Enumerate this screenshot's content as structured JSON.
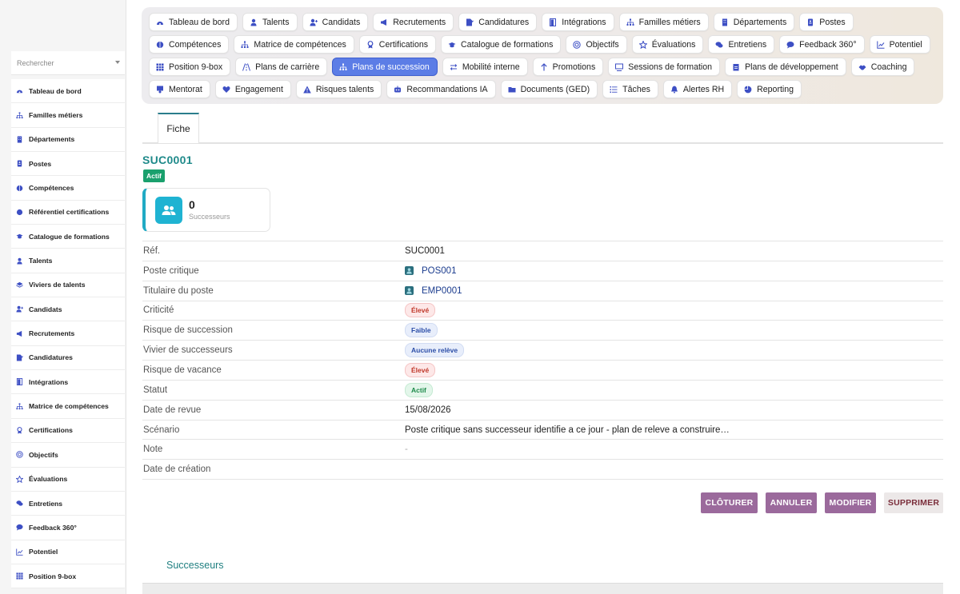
{
  "sidebar": {
    "search_placeholder": "Rechercher",
    "items": [
      {
        "label": "Tableau de bord",
        "icon": "dashboard-icon"
      },
      {
        "label": "Familles métiers",
        "icon": "sitemap-icon"
      },
      {
        "label": "Départements",
        "icon": "building-icon"
      },
      {
        "label": "Postes",
        "icon": "badge-icon"
      },
      {
        "label": "Compétences",
        "icon": "brain-icon"
      },
      {
        "label": "Référentiel certifications",
        "icon": "certificate-icon"
      },
      {
        "label": "Catalogue de formations",
        "icon": "graduation-cap-icon"
      },
      {
        "label": "Talents",
        "icon": "user-icon"
      },
      {
        "label": "Viviers de talents",
        "icon": "layers-icon"
      },
      {
        "label": "Candidats",
        "icon": "user-plus-icon"
      },
      {
        "label": "Recrutements",
        "icon": "megaphone-icon"
      },
      {
        "label": "Candidatures",
        "icon": "file-signature-icon"
      },
      {
        "label": "Intégrations",
        "icon": "door-icon"
      },
      {
        "label": "Matrice de compétences",
        "icon": "sitemap-icon"
      },
      {
        "label": "Certifications",
        "icon": "award-icon"
      },
      {
        "label": "Objectifs",
        "icon": "target-icon"
      },
      {
        "label": "Évaluations",
        "icon": "star-icon"
      },
      {
        "label": "Entretiens",
        "icon": "comments-icon"
      },
      {
        "label": "Feedback 360°",
        "icon": "comment-icon"
      },
      {
        "label": "Potentiel",
        "icon": "chart-line-icon"
      },
      {
        "label": "Position 9-box",
        "icon": "grid-icon"
      }
    ]
  },
  "nav": {
    "chips": [
      {
        "label": "Tableau de bord",
        "icon": "dashboard-icon",
        "active": false
      },
      {
        "label": "Talents",
        "icon": "user-icon",
        "active": false
      },
      {
        "label": "Candidats",
        "icon": "user-plus-icon",
        "active": false
      },
      {
        "label": "Recrutements",
        "icon": "megaphone-icon",
        "active": false
      },
      {
        "label": "Candidatures",
        "icon": "file-signature-icon",
        "active": false
      },
      {
        "label": "Intégrations",
        "icon": "door-icon",
        "active": false
      },
      {
        "label": "Familles métiers",
        "icon": "sitemap-icon",
        "active": false
      },
      {
        "label": "Départements",
        "icon": "building-icon",
        "active": false
      },
      {
        "label": "Postes",
        "icon": "badge-icon",
        "active": false
      },
      {
        "label": "Compétences",
        "icon": "brain-icon",
        "active": false
      },
      {
        "label": "Matrice de compétences",
        "icon": "sitemap-icon",
        "active": false
      },
      {
        "label": "Certifications",
        "icon": "award-icon",
        "active": false
      },
      {
        "label": "Catalogue de formations",
        "icon": "graduation-cap-icon",
        "active": false
      },
      {
        "label": "Objectifs",
        "icon": "target-icon",
        "active": false
      },
      {
        "label": "Évaluations",
        "icon": "star-icon",
        "active": false
      },
      {
        "label": "Entretiens",
        "icon": "comments-icon",
        "active": false
      },
      {
        "label": "Feedback 360°",
        "icon": "comment-icon",
        "active": false
      },
      {
        "label": "Potentiel",
        "icon": "chart-line-icon",
        "active": false
      },
      {
        "label": "Position 9-box",
        "icon": "grid-icon",
        "active": false
      },
      {
        "label": "Plans de carrière",
        "icon": "road-icon",
        "active": false
      },
      {
        "label": "Plans de succession",
        "icon": "sitemap-icon",
        "active": true
      },
      {
        "label": "Mobilité interne",
        "icon": "exchange-icon",
        "active": false
      },
      {
        "label": "Promotions",
        "icon": "arrow-up-icon",
        "active": false
      },
      {
        "label": "Sessions de formation",
        "icon": "chalkboard-icon",
        "active": false
      },
      {
        "label": "Plans de développement",
        "icon": "clipboard-icon",
        "active": false
      },
      {
        "label": "Coaching",
        "icon": "handshake-icon",
        "active": false
      },
      {
        "label": "Mentorat",
        "icon": "mentor-icon",
        "active": false
      },
      {
        "label": "Engagement",
        "icon": "heart-icon",
        "active": false
      },
      {
        "label": "Risques talents",
        "icon": "warning-icon",
        "active": false
      },
      {
        "label": "Recommandations IA",
        "icon": "robot-icon",
        "active": false
      },
      {
        "label": "Documents (GED)",
        "icon": "folder-icon",
        "active": false
      },
      {
        "label": "Tâches",
        "icon": "list-icon",
        "active": false
      },
      {
        "label": "Alertes RH",
        "icon": "bell-icon",
        "active": false
      },
      {
        "label": "Reporting",
        "icon": "pie-chart-icon",
        "active": false
      }
    ]
  },
  "tabs": {
    "fiche": "Fiche"
  },
  "record": {
    "title": "SUC0001",
    "status_badge": "Actif",
    "stat": {
      "value": "0",
      "label": "Successeurs",
      "icon": "users-icon"
    }
  },
  "fields": [
    {
      "label": "Réf.",
      "type": "text",
      "value": "SUC0001"
    },
    {
      "label": "Poste critique",
      "type": "link",
      "value": "POS001"
    },
    {
      "label": "Titulaire du poste",
      "type": "link",
      "value": "EMP0001"
    },
    {
      "label": "Criticité",
      "type": "pill",
      "value": "Élevé",
      "color": "red"
    },
    {
      "label": "Risque de succession",
      "type": "pill",
      "value": "Faible",
      "color": "blue"
    },
    {
      "label": "Vivier de successeurs",
      "type": "pill",
      "value": "Aucune relève",
      "color": "blue"
    },
    {
      "label": "Risque de vacance",
      "type": "pill",
      "value": "Élevé",
      "color": "red"
    },
    {
      "label": "Statut",
      "type": "pill",
      "value": "Actif",
      "color": "green"
    },
    {
      "label": "Date de revue",
      "type": "text",
      "value": "15/08/2026"
    },
    {
      "label": "Scénario",
      "type": "text",
      "value": "Poste critique sans successeur identifie a ce jour - plan de releve a construire…"
    },
    {
      "label": "Note",
      "type": "dash",
      "value": "-"
    },
    {
      "label": "Date de création",
      "type": "text",
      "value": ""
    }
  ],
  "actions": {
    "close": "CLÔTURER",
    "cancel": "ANNULER",
    "edit": "MODIFIER",
    "delete": "SUPPRIMER"
  },
  "successors": {
    "title": "Successeurs"
  },
  "colors": {
    "accent": "#5c7de6",
    "teal": "#1f8a8a",
    "purple_button": "#9b6a9c",
    "icon_blue": "#3d4fc4"
  }
}
